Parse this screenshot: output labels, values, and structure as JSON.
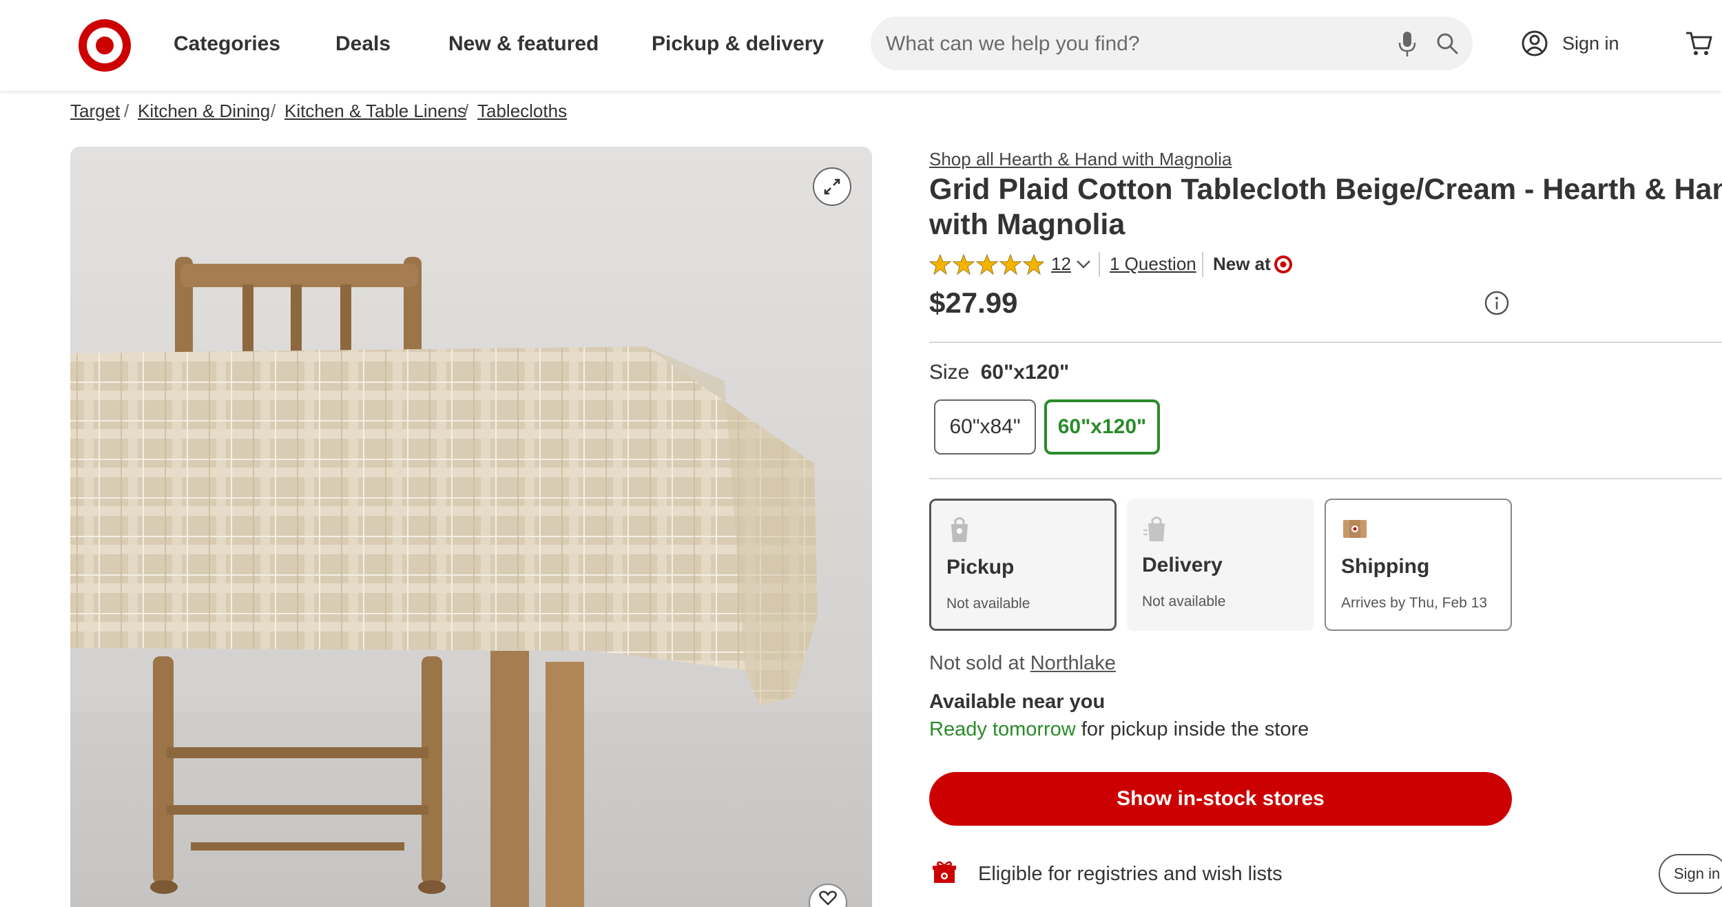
{
  "header": {
    "nav": [
      "Categories",
      "Deals",
      "New & featured",
      "Pickup & delivery"
    ],
    "search_placeholder": "What can we help you find?",
    "sign_in": "Sign in"
  },
  "breadcrumb": [
    "Target",
    "Kitchen & Dining",
    "Kitchen & Table Linens",
    "Tablecloths"
  ],
  "product": {
    "brand_link": "Shop all Hearth & Hand with Magnolia",
    "title_line1": "Grid Plaid Cotton Tablecloth Beige/Cream - Hearth & Hand™",
    "title_line2": "with Magnolia",
    "rating_stars": 5,
    "review_count": "12",
    "questions": "1 Question",
    "new_at": "New at",
    "price": "$27.99",
    "size_label": "Size",
    "size_selected": "60\"x120\"",
    "sizes": [
      "60\"x84\"",
      "60\"x120\""
    ]
  },
  "fulfillment": [
    {
      "title": "Pickup",
      "status": "Not available"
    },
    {
      "title": "Delivery",
      "status": "Not available"
    },
    {
      "title": "Shipping",
      "status": "Arrives by Thu, Feb 13"
    }
  ],
  "store": {
    "not_sold_prefix": "Not sold at",
    "store_name": "Northlake",
    "available_heading": "Available near you",
    "ready_label": "Ready tomorrow",
    "ready_rest": "for pickup inside the store"
  },
  "cta": "Show in-stock stores",
  "registry_text": "Eligible for registries and wish lists",
  "floating_sign_in": "Sign in",
  "colors": {
    "brand_red": "#cc0000",
    "selected_green": "#2a8b2a",
    "ready_green": "#2a8b2a"
  }
}
